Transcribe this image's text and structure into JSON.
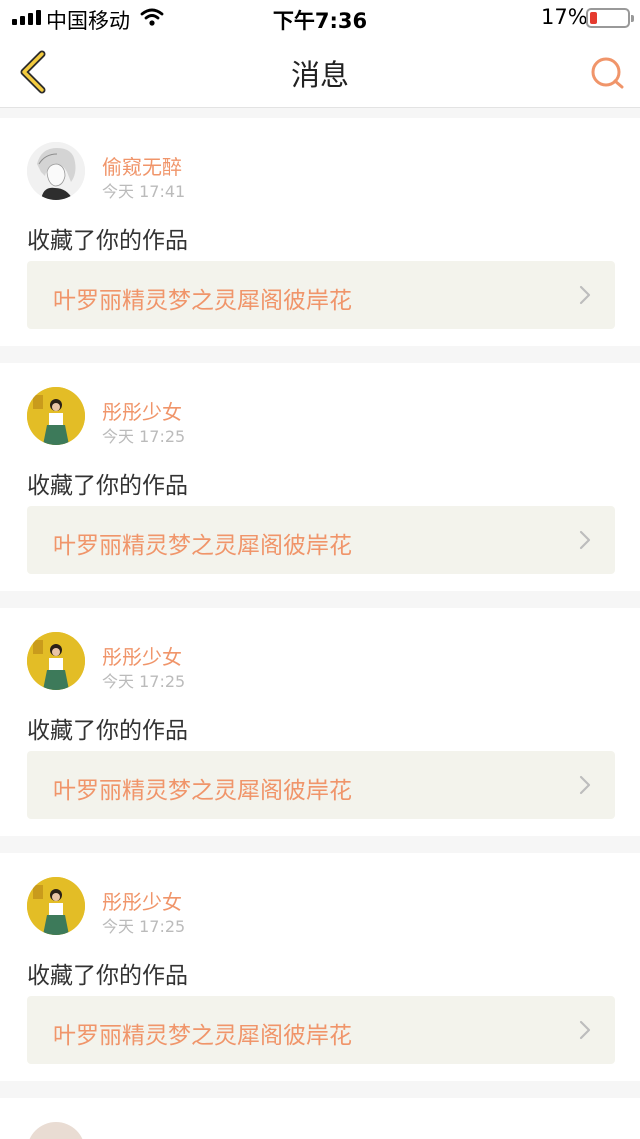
{
  "status_bar": {
    "carrier": "中国移动",
    "time": "下午7:36",
    "battery": "17%",
    "battery_level": 0.17
  },
  "nav": {
    "title": "消息",
    "back_icon": "chevron-left-icon",
    "search_icon": "search-icon"
  },
  "accent_color": "#f0956a",
  "messages": [
    {
      "user": "偷窥无醉",
      "time": "今天 17:41",
      "action": "收藏了你的作品",
      "work": "叶罗丽精灵梦之灵犀阁彼岸花"
    },
    {
      "user": "彤彤少女",
      "time": "今天 17:25",
      "action": "收藏了你的作品",
      "work": "叶罗丽精灵梦之灵犀阁彼岸花"
    },
    {
      "user": "彤彤少女",
      "time": "今天 17:25",
      "action": "收藏了你的作品",
      "work": "叶罗丽精灵梦之灵犀阁彼岸花"
    },
    {
      "user": "彤彤少女",
      "time": "今天 17:25",
      "action": "收藏了你的作品",
      "work": "叶罗丽精灵梦之灵犀阁彼岸花"
    }
  ]
}
